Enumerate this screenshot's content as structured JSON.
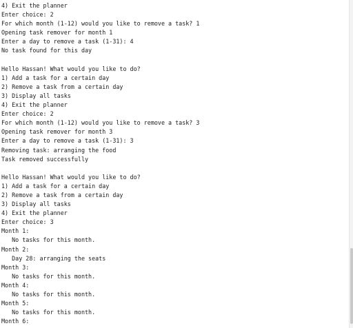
{
  "console": {
    "lines": [
      "4) Exit the planner",
      "Enter choice: 2",
      "For which month (1-12) would you like to remove a task? 1",
      "Opening task remover for month 1",
      "Enter a day to remove a task (1-31): 4",
      "No task found for this day",
      "",
      "Hello Hassan! What would you like to do?",
      "1) Add a task for a certain day",
      "2) Remove a task from a certain day",
      "3) Display all tasks",
      "4) Exit the planner",
      "Enter choice: 2",
      "For which month (1-12) would you like to remove a task? 3",
      "Opening task remover for month 3",
      "Enter a day to remove a task (1-31): 3",
      "Removing task: arranging the food",
      "Task removed successfully",
      "",
      "Hello Hassan! What would you like to do?",
      "1) Add a task for a certain day",
      "2) Remove a task from a certain day",
      "3) Display all tasks",
      "4) Exit the planner",
      "Enter choice: 3",
      "Month 1:",
      "   No tasks for this month.",
      "Month 2:",
      "   Day 28: arranging the seats",
      "Month 3:",
      "   No tasks for this month.",
      "Month 4:",
      "   No tasks for this month.",
      "Month 5:",
      "   No tasks for this month.",
      "Month 6:"
    ]
  }
}
